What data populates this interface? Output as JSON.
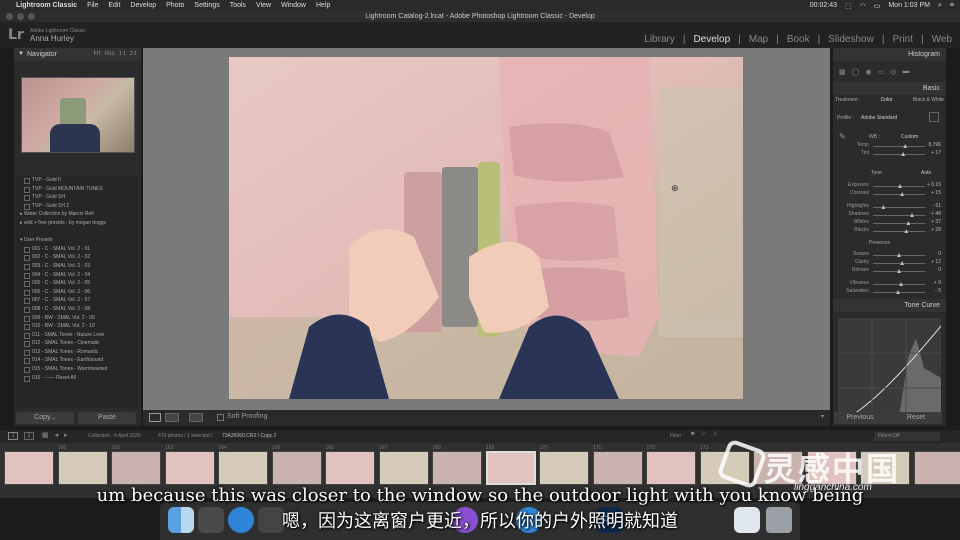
{
  "mac_menu": {
    "apple": "",
    "app": "Lightroom Classic",
    "items": [
      "File",
      "Edit",
      "Develop",
      "Photo",
      "Settings",
      "Tools",
      "View",
      "Window",
      "Help"
    ],
    "time_elapsed": "00:02:43",
    "clock": "Mon 1:03 PM"
  },
  "window": {
    "title": "Lightroom Catalog-2.lrcat - Adobe Photoshop Lightroom Classic - Develop"
  },
  "lr_header": {
    "logo": "Lr",
    "subtitle": "Adobe Lightroom Classic",
    "user": "Anna Hurley",
    "modules": [
      "Library",
      "Develop",
      "Map",
      "Book",
      "Slideshow",
      "Print",
      "Web"
    ],
    "active_module": "Develop"
  },
  "navigator": {
    "title": "Navigator",
    "zoom_options": [
      "FIT",
      "FILL",
      "1:1",
      "2:1"
    ]
  },
  "presets": [
    {
      "type": "item",
      "label": "TVP - Gold II"
    },
    {
      "type": "item",
      "label": "TVP - Gold MOUNTAIN TONES"
    },
    {
      "type": "item",
      "label": "TVP - Gold SH"
    },
    {
      "type": "item",
      "label": "TVP - Gold SH 2"
    },
    {
      "type": "grp",
      "label": "▸ Water Collection by Marcio Reif"
    },
    {
      "type": "grp",
      "label": "▸ wild + free presets - by megan boggs"
    },
    {
      "type": "gap",
      "label": ""
    },
    {
      "type": "grp",
      "label": "▾ User Presets"
    },
    {
      "type": "item",
      "label": "001 - C - SMAL Vol. 2 - 01"
    },
    {
      "type": "item",
      "label": "002 - C - SMAL Vol. 2 - 02"
    },
    {
      "type": "item",
      "label": "003 - C - SMAL Vol. 2 - 03"
    },
    {
      "type": "item",
      "label": "004 - C - SMAL Vol. 2 - 04"
    },
    {
      "type": "item",
      "label": "005 - C - SMAL Vol. 2 - 05"
    },
    {
      "type": "item",
      "label": "006 - C - SMAL Vol. 2 - 06"
    },
    {
      "type": "item",
      "label": "007 - C - SMAL Vol. 2 - 07"
    },
    {
      "type": "item",
      "label": "008 - C - SMAL Vol. 2 - 08"
    },
    {
      "type": "item",
      "label": "009 - BW - SMAL Vol. 2 - 09"
    },
    {
      "type": "item",
      "label": "010 - BW - SMAL Vol. 2 - 10"
    },
    {
      "type": "item",
      "label": "011 - SMAL Tones - Nature Love"
    },
    {
      "type": "item",
      "label": "012 - SMAL Tones - Cinematic"
    },
    {
      "type": "item",
      "label": "013 - SMAL Tones - Romantic"
    },
    {
      "type": "item",
      "label": "014 - SMAL Tones - Earthbound"
    },
    {
      "type": "item",
      "label": "015 - SMAL Tones - Warmhearted"
    },
    {
      "type": "item",
      "label": "016 - ------ Reset All"
    }
  ],
  "left_buttons": {
    "copy": "Copy...",
    "paste": "Paste"
  },
  "toolbar": {
    "soft_proofing": "Soft Proofing"
  },
  "histogram": {
    "title": "Histogram"
  },
  "basic": {
    "title": "Basic",
    "treatment_modes": [
      "Treatment :",
      "Color",
      "Black & White"
    ],
    "profile_label": "Profile :",
    "profile_value": "Adobe Standard",
    "wb_label": "WB :",
    "wb_value": "Custom",
    "tone_label": "Tone",
    "auto_label": "Auto",
    "presence_label": "Presence",
    "sliders": [
      {
        "label": "Temp",
        "value": "8,796",
        "pos": 0.62
      },
      {
        "label": "Tint",
        "value": "+ 17",
        "pos": 0.58
      },
      {
        "label": "Exposure",
        "value": "+ 0.15",
        "pos": 0.52
      },
      {
        "label": "Contrast",
        "value": "+ 15",
        "pos": 0.56
      },
      {
        "label": "Highlights",
        "value": "- 61",
        "pos": 0.2
      },
      {
        "label": "Shadows",
        "value": "+ 48",
        "pos": 0.75
      },
      {
        "label": "Whites",
        "value": "+ 37",
        "pos": 0.68
      },
      {
        "label": "Blacks",
        "value": "+ 28",
        "pos": 0.64
      },
      {
        "label": "Texture",
        "value": "0",
        "pos": 0.5
      },
      {
        "label": "Clarity",
        "value": "+ 12",
        "pos": 0.56
      },
      {
        "label": "Dehaze",
        "value": "0",
        "pos": 0.5
      },
      {
        "label": "Vibrance",
        "value": "+ 9",
        "pos": 0.54
      },
      {
        "label": "Saturation",
        "value": "- 5",
        "pos": 0.48
      }
    ]
  },
  "tone_curve": {
    "title": "Tone Curve"
  },
  "right_buttons": {
    "previous": "Previous",
    "reset": "Reset"
  },
  "filmstrip_bar": {
    "page1": "1",
    "page2": "2",
    "source": "Collection : 4 April 2020",
    "count": "473 photos / 1 selected /",
    "file": "73A35060.CR3 / Copy 2",
    "filter_label": "Filter :",
    "filter_value": "Filters Off"
  },
  "filmstrip": {
    "numbers": [
      "161",
      "162",
      "163",
      "164",
      "165",
      "166",
      "167",
      "168",
      "169",
      "170",
      "171",
      "172",
      "173"
    ]
  },
  "subtitles": {
    "english": "um because this was closer to the window so the outdoor light with you know being",
    "chinese": "嗯，因为这离窗户更近，所以你的户外照明就知道"
  },
  "watermark": {
    "main": "灵感中国",
    "url": "lingganchina.com"
  },
  "colors": {
    "accent": "#dddddd",
    "panel": "#2b2b2b"
  }
}
